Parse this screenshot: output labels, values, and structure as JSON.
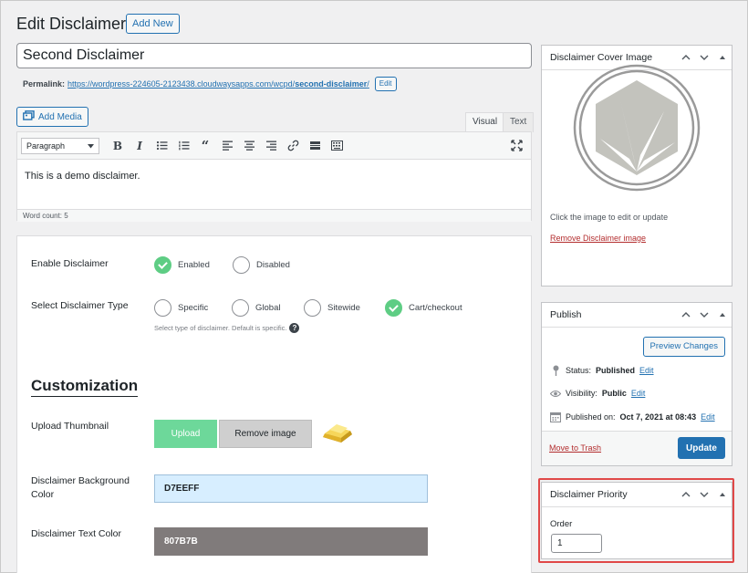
{
  "header": {
    "title": "Edit Disclaimer",
    "add_new_label": "Add New"
  },
  "post": {
    "title": "Second Disclaimer",
    "permalink_label": "Permalink:",
    "permalink_base": "https://wordpress-224605-2123438.cloudwaysapps.com/wcpd/",
    "permalink_slug": "second-disclaimer",
    "permalink_tail": "/",
    "permalink_edit_label": "Edit"
  },
  "editor": {
    "add_media_label": "Add Media",
    "tab_visual": "Visual",
    "tab_text": "Text",
    "format_value": "Paragraph",
    "content": "This is a demo disclaimer.",
    "word_count": "Word count: 5"
  },
  "settings": {
    "enable_label": "Enable Disclaimer",
    "enable_options": [
      {
        "label": "Enabled",
        "checked": true
      },
      {
        "label": "Disabled",
        "checked": false
      }
    ],
    "type_label": "Select Disclaimer Type",
    "type_options": [
      {
        "label": "Specific",
        "checked": false
      },
      {
        "label": "Global",
        "checked": false
      },
      {
        "label": "Sitewide",
        "checked": false
      },
      {
        "label": "Cart/checkout",
        "checked": true
      }
    ],
    "type_hint": "Select type of disclaimer. Default is specific.",
    "customization_heading": "Customization",
    "thumbnail_label": "Upload Thumbnail",
    "upload_label": "Upload",
    "remove_image_label": "Remove image",
    "bg_color_label": "Disclaimer Background Color",
    "bg_color_value": "D7EEFF",
    "bg_color_swatch": "#d7eeff",
    "text_color_label": "Disclaimer Text Color",
    "text_color_value": "807B7B",
    "text_color_swatch": "#807b7b",
    "accent_color": "#5ecd84"
  },
  "cover_box": {
    "title": "Disclaimer Cover Image",
    "note": "Click the image to edit or update",
    "remove_label": "Remove Disclaimer image"
  },
  "publish_box": {
    "title": "Publish",
    "preview_label": "Preview Changes",
    "status_label": "Status:",
    "status_value": "Published",
    "visibility_label": "Visibility:",
    "visibility_value": "Public",
    "published_label": "Published on:",
    "published_value": "Oct 7, 2021 at 08:43",
    "edit_label": "Edit",
    "trash_label": "Move to Trash",
    "update_label": "Update"
  },
  "priority_box": {
    "title": "Disclaimer Priority",
    "order_label": "Order",
    "order_value": "1"
  }
}
